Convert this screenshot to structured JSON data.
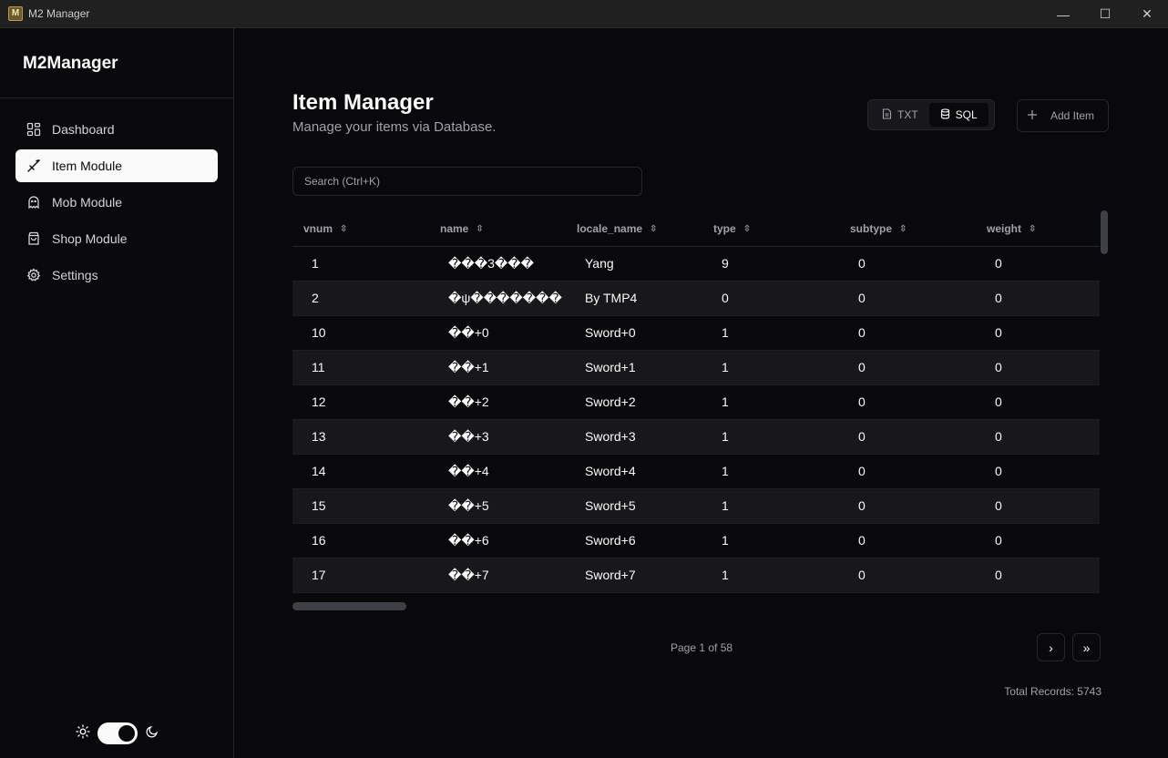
{
  "window": {
    "title": "M2 Manager",
    "minimize": "—",
    "maximize": "☐",
    "close": "✕"
  },
  "sidebar": {
    "brand": "M2Manager",
    "items": [
      {
        "label": "Dashboard",
        "icon": "grid-icon"
      },
      {
        "label": "Item Module",
        "icon": "sword-icon",
        "active": true
      },
      {
        "label": "Mob Module",
        "icon": "ghost-icon"
      },
      {
        "label": "Shop Module",
        "icon": "shopping-bag-icon"
      },
      {
        "label": "Settings",
        "icon": "gear-icon"
      }
    ],
    "theme": {
      "mode": "dark"
    }
  },
  "main": {
    "title": "Item Manager",
    "subtitle": "Manage your items via Database.",
    "mode_txt": "TXT",
    "mode_sql": "SQL",
    "active_mode": "SQL",
    "add_label": "Add Item",
    "search_placeholder": "Search (Ctrl+K)"
  },
  "table": {
    "columns": [
      "vnum",
      "name",
      "locale_name",
      "type",
      "subtype",
      "weight"
    ],
    "rows": [
      [
        "1",
        "���3���",
        "Yang",
        "9",
        "0",
        "0"
      ],
      [
        "2",
        "�ψ�������",
        "By TMP4",
        "0",
        "0",
        "0"
      ],
      [
        "10",
        "��+0",
        "Sword+0",
        "1",
        "0",
        "0"
      ],
      [
        "11",
        "��+1",
        "Sword+1",
        "1",
        "0",
        "0"
      ],
      [
        "12",
        "��+2",
        "Sword+2",
        "1",
        "0",
        "0"
      ],
      [
        "13",
        "��+3",
        "Sword+3",
        "1",
        "0",
        "0"
      ],
      [
        "14",
        "��+4",
        "Sword+4",
        "1",
        "0",
        "0"
      ],
      [
        "15",
        "��+5",
        "Sword+5",
        "1",
        "0",
        "0"
      ],
      [
        "16",
        "��+6",
        "Sword+6",
        "1",
        "0",
        "0"
      ],
      [
        "17",
        "��+7",
        "Sword+7",
        "1",
        "0",
        "0"
      ]
    ]
  },
  "pagination": {
    "text": "Page 1 of 58",
    "next": "›",
    "last": "»"
  },
  "total": "Total Records: 5743",
  "colors": {
    "background": "#09090b",
    "border": "#27272a",
    "muted": "#a1a1aa",
    "active": "#fafafa"
  }
}
